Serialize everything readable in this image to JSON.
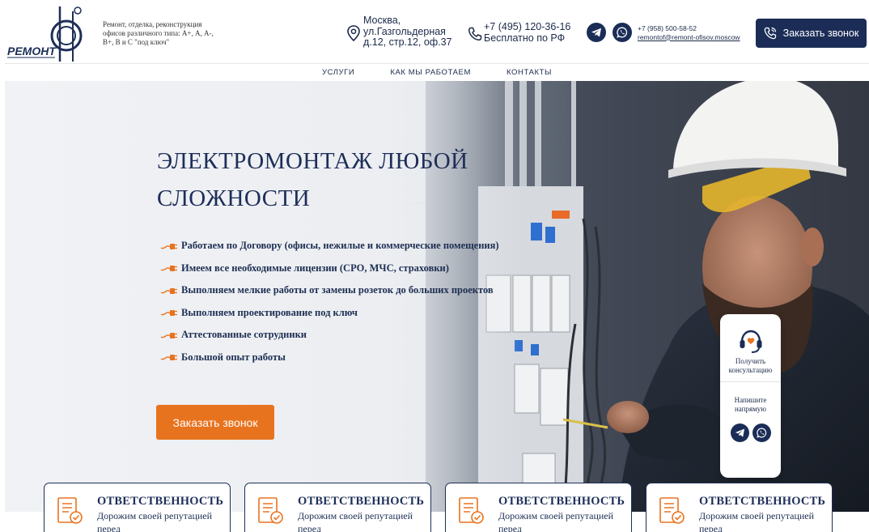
{
  "header": {
    "logo_text": "РЕМОНТ",
    "tagline": "Ремонт, отделка, реконструкция офисов различного типа: А+, А, А-, В+, В и С \"под ключ\"",
    "address": [
      "Москва,",
      "ул.Газгольдерная",
      "д.12, стр.12, оф.37"
    ],
    "phone": "+7 (495) 120-36-16",
    "phone_note": "Бесплатно по РФ",
    "phone2": "+7 (958) 500-58-52",
    "email": "remontof@remont-ofisov.moscow",
    "call_button": "Заказать звонок",
    "icons": {
      "address": "map-pin-icon",
      "phone": "phone-icon",
      "telegram": "telegram-icon",
      "whatsapp": "whatsapp-icon",
      "call": "phone-call-icon"
    }
  },
  "nav": {
    "items": [
      "УСЛУГИ",
      "КАК МЫ РАБОТАЕМ",
      "КОНТАКТЫ"
    ]
  },
  "hero": {
    "title_line1": "ЭЛЕКТРОМОНТАЖ ЛЮБОЙ",
    "title_line2": "СЛОЖНОСТИ",
    "features": [
      "Работаем по Договору (офисы, нежилые и коммерческие помещения)",
      "Имеем все необходимые лицензии (СРО, МЧС, страховки)",
      "Выполняем мелкие работы от замены розеток до больших проектов",
      "Выполняем проектирование под ключ",
      "Аттестованные сотрудники",
      "Большой опыт работы"
    ],
    "button": "Заказать звонок"
  },
  "widget": {
    "consult": "Получить консультацию",
    "write": "Напишите напрямую"
  },
  "cards": [
    {
      "title": "ОТВЕТСТВЕННОСТЬ",
      "text": "Дорожим своей репутацией перед"
    },
    {
      "title": "ОТВЕТСТВЕННОСТЬ",
      "text": "Дорожим своей репутацией перед"
    },
    {
      "title": "ОТВЕТСТВЕННОСТЬ",
      "text": "Дорожим своей репутацией перед"
    },
    {
      "title": "ОТВЕТСТВЕННОСТЬ",
      "text": "Дорожим своей репутацией перед"
    }
  ],
  "colors": {
    "brand_navy": "#1b2d57",
    "accent_orange": "#e8731e"
  }
}
